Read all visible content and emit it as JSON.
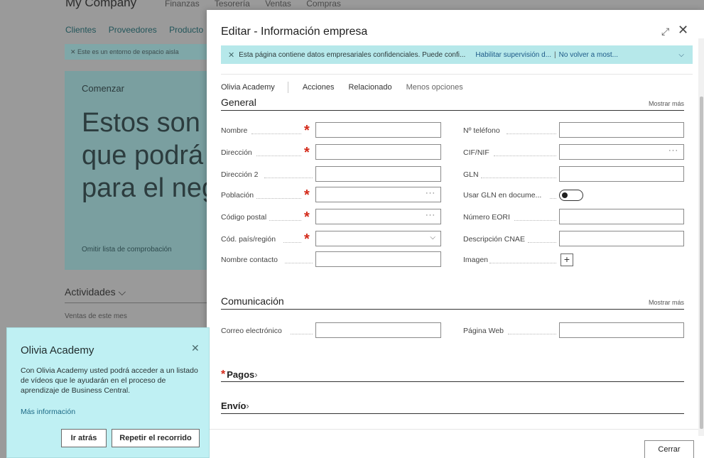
{
  "background": {
    "company": "My Company",
    "top_menu": [
      "Finanzas",
      "Tesorería",
      "Ventas",
      "Compras"
    ],
    "sub_nav": [
      "Clientes",
      "Proveedores",
      "Producto"
    ],
    "banner": "✕  Este es un entorno de espacio aisla",
    "card_label": "Comenzar",
    "card_title_lines": [
      "Estos son p",
      "que podrá",
      "para el neg"
    ],
    "card_skip": "Omitir lista de comprobación",
    "actividades": "Actividades",
    "ventas": "Ventas de este mes"
  },
  "dialog": {
    "title": "Editar - Información empresa",
    "banner": {
      "message": "Esta página contiene datos empresariales confidenciales. Puede confi...",
      "link1": "Habilitar supervisión d...",
      "separator": "|",
      "link2": "No volver a most..."
    },
    "actions": {
      "company": "Olivia Academy",
      "acciones": "Acciones",
      "relacionado": "Relacionado",
      "menos": "Menos opciones"
    },
    "general": {
      "title": "General",
      "more": "Mostrar más",
      "left_fields": [
        {
          "label": "Nombre",
          "required": true,
          "value": ""
        },
        {
          "label": "Dirección",
          "required": true,
          "value": ""
        },
        {
          "label": "Dirección 2",
          "required": false,
          "value": ""
        },
        {
          "label": "Población",
          "required": true,
          "value": ""
        },
        {
          "label": "Código postal",
          "required": true,
          "value": ""
        },
        {
          "label": "Cód. país/región",
          "required": true,
          "value": ""
        },
        {
          "label": "Nombre contacto",
          "required": false,
          "value": ""
        }
      ],
      "right_fields": [
        {
          "label": "Nº teléfono",
          "value": ""
        },
        {
          "label": "CIF/NIF",
          "value": ""
        },
        {
          "label": "GLN",
          "value": ""
        },
        {
          "label": "Usar GLN en docume...",
          "value": "off"
        },
        {
          "label": "Número EORI",
          "value": ""
        },
        {
          "label": "Descripción CNAE",
          "value": ""
        },
        {
          "label": "Imagen",
          "value": ""
        }
      ]
    },
    "comunicacion": {
      "title": "Comunicación",
      "more": "Mostrar más",
      "email_label": "Correo electrónico",
      "web_label": "Página Web"
    },
    "pagos": "Pagos",
    "envio": "Envío",
    "close_button": "Cerrar"
  },
  "olivia": {
    "title": "Olivia Academy",
    "body": "Con Olivia Academy usted podrá acceder a un listado de vídeos que le ayudarán en el proceso de aprendizaje de Business Central.",
    "link": "Más información",
    "back_button": "Ir atrás",
    "repeat_button": "Repetir el recorrido"
  }
}
